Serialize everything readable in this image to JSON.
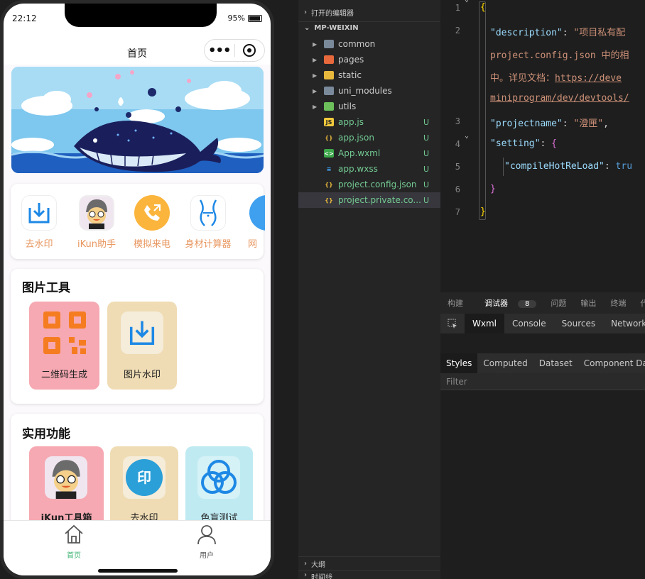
{
  "phone": {
    "status": {
      "time": "22:12",
      "battery": "95%"
    },
    "nav": {
      "title": "首页"
    },
    "quick_tools": [
      {
        "label": "去水印",
        "icon": "download-icon"
      },
      {
        "label": "iKun助手",
        "icon": "ikun-avatar-icon"
      },
      {
        "label": "模拟来电",
        "icon": "phone-call-icon"
      },
      {
        "label": "身材计算器",
        "icon": "body-shape-icon"
      },
      {
        "label": "网",
        "icon": "globe-icon"
      }
    ],
    "image_tools": {
      "title": "图片工具",
      "items": [
        {
          "label": "二维码生成",
          "icon": "qrcode-icon"
        },
        {
          "label": "图片水印",
          "icon": "download-icon"
        }
      ]
    },
    "util_tools": {
      "title": "实用功能",
      "items": [
        {
          "label": "iKun工具箱",
          "icon": "ikun-avatar-icon"
        },
        {
          "label": "去水印",
          "icon": "stamp-icon"
        },
        {
          "label": "色盲测试",
          "icon": "color-circles-icon"
        }
      ]
    },
    "tabbar": {
      "home": "首页",
      "user": "用户",
      "active_color": "#3cb371"
    }
  },
  "explorer": {
    "open_editors": "打开的编辑器",
    "project": "MP-WEIXIN",
    "folders": [
      "common",
      "pages",
      "static",
      "uni_modules",
      "utils"
    ],
    "files": [
      {
        "name": "app.js",
        "status": "U"
      },
      {
        "name": "app.json",
        "status": "U"
      },
      {
        "name": "App.wxml",
        "status": "U"
      },
      {
        "name": "app.wxss",
        "status": "U"
      },
      {
        "name": "project.config.json",
        "status": "U"
      },
      {
        "name": "project.private.co...",
        "status": "U"
      }
    ],
    "outline": "大纲",
    "timeline": "时间线"
  },
  "editor": {
    "line_numbers": [
      "1",
      "2",
      "",
      "",
      "3",
      "4",
      "5",
      "6",
      "7"
    ],
    "brace_open": "{",
    "description_key": "\"description\"",
    "description_val_1": "\"项目私有配",
    "description_val_2": "project.config.json 中的相",
    "description_val_3a": "中。详见文档：",
    "description_val_3b": "https://deve",
    "description_val_4": "miniprogram/dev/devtools/",
    "projectname_key": "\"projectname\"",
    "projectname_val": "\"澄匣\"",
    "setting_key": "\"setting\"",
    "compile_key": "\"compileHotReLoad\"",
    "compile_val": "tru",
    "brace_close_inner": "}",
    "brace_close": "}"
  },
  "devtools": {
    "tabs": [
      "构建",
      "调试器",
      "问题",
      "输出",
      "终端",
      "代码"
    ],
    "badge": "8",
    "panels": [
      "Wxml",
      "Console",
      "Sources",
      "Network"
    ],
    "sub_tabs": [
      "Styles",
      "Computed",
      "Dataset",
      "Component Data"
    ],
    "filter_placeholder": "Filter"
  }
}
